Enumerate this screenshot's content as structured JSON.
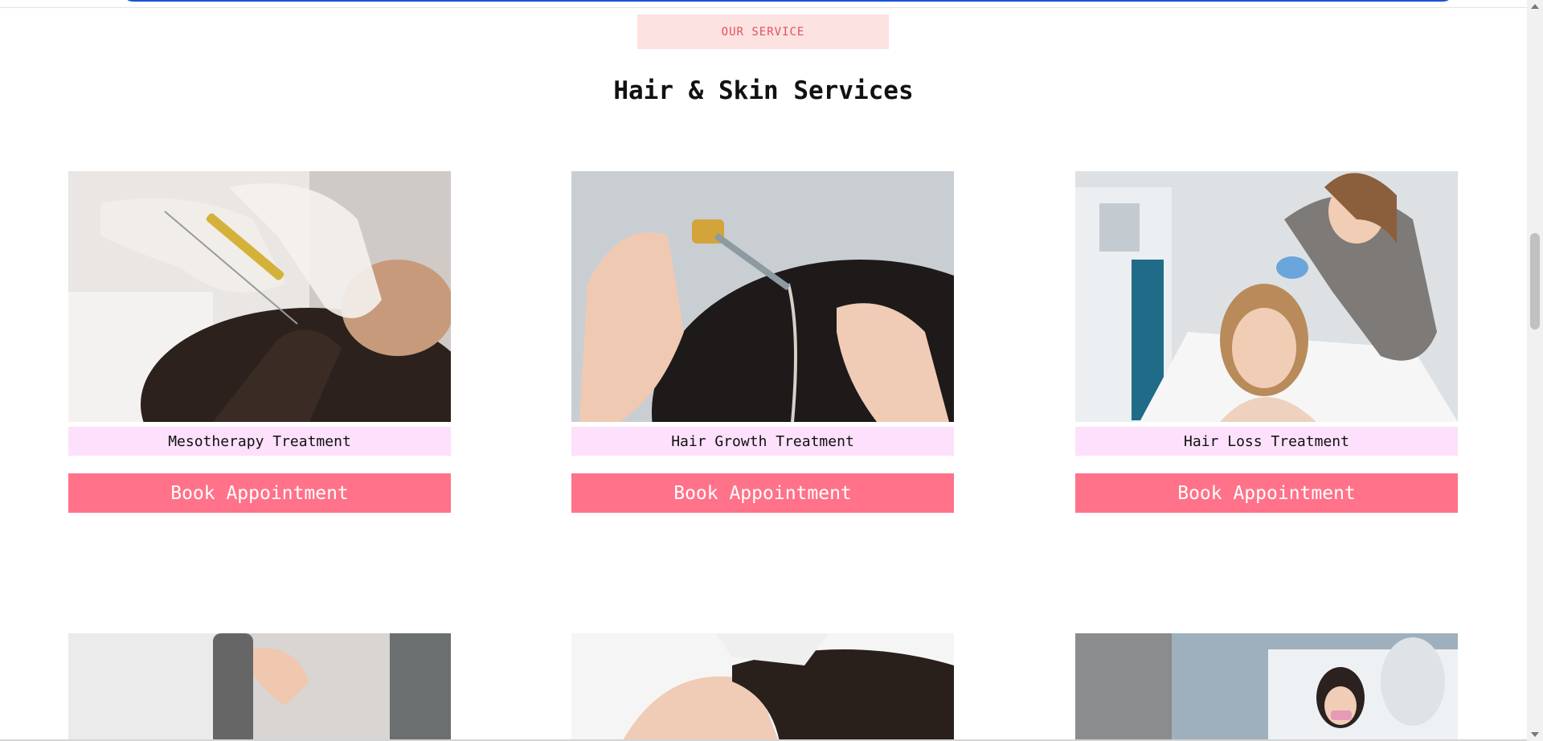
{
  "section": {
    "tag": "OUR SERVICE",
    "title": "Hair & Skin Services"
  },
  "services": [
    {
      "name": "Mesotherapy Treatment",
      "button": "Book Appointment"
    },
    {
      "name": "Hair Growth Treatment",
      "button": "Book Appointment"
    },
    {
      "name": "Hair Loss Treatment",
      "button": "Book Appointment"
    }
  ],
  "colors": {
    "tag_bg": "#fde2e2",
    "tag_text": "#e0525a",
    "label_bg": "#fde0fb",
    "button_bg": "#ff7289",
    "nav_border": "#1a53d6"
  }
}
